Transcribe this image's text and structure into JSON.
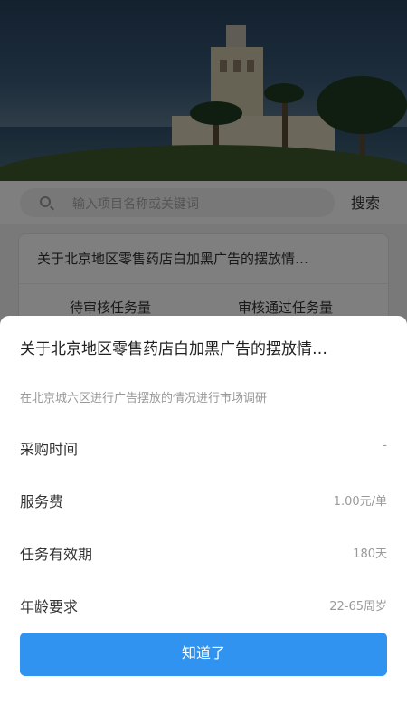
{
  "search": {
    "placeholder": "输入项目名称或关键词",
    "button_label": "搜索"
  },
  "card": {
    "title": "关于北京地区零售药店白加黑广告的摆放情…",
    "stat_pending_label": "待审核任务量",
    "stat_approved_label": "审核通过任务量"
  },
  "sheet": {
    "title": "关于北京地区零售药店白加黑广告的摆放情…",
    "description": "在北京城六区进行广告摆放的情况进行市场调研",
    "rows": [
      {
        "label": "采购时间",
        "value": "-"
      },
      {
        "label": "服务费",
        "value": "1.00元/单"
      },
      {
        "label": "任务有效期",
        "value": "180天"
      },
      {
        "label": "年龄要求",
        "value": "22-65周岁"
      }
    ],
    "confirm_label": "知道了"
  },
  "colors": {
    "accent": "#2f93ef",
    "overlay": "rgba(0,0,0,0.5)"
  }
}
